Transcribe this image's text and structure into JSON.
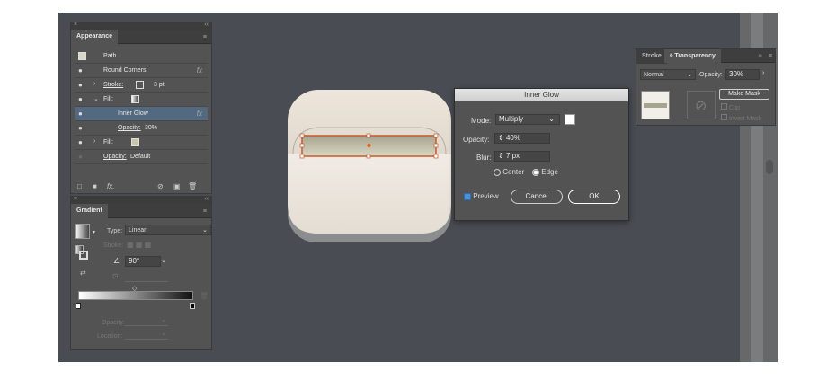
{
  "appearance": {
    "title": "Appearance",
    "rows": [
      {
        "label": "Path"
      },
      {
        "label": "Round Corners",
        "fx": "fx"
      },
      {
        "label": "Stroke:",
        "value": "3 pt"
      },
      {
        "label": "Fill:"
      },
      {
        "label": "Inner Glow",
        "fx": "fx"
      },
      {
        "label": "Opacity:",
        "value": "30%"
      },
      {
        "label": "Fill:"
      },
      {
        "label": "Opacity:",
        "value": "Default"
      }
    ],
    "bottom_fx": "fx."
  },
  "gradient": {
    "title": "Gradient",
    "type_label": "Type:",
    "type_value": "Linear",
    "stroke_label": "Stroke:",
    "angle_value": "90°",
    "opacity_label": "Opacity:",
    "location_label": "Location:"
  },
  "transparency": {
    "tab_stroke": "Stroke",
    "tab_transparency": "Transparency",
    "blend_mode": "Normal",
    "opacity_label": "Opacity:",
    "opacity_value": "30%",
    "make_mask": "Make Mask",
    "clip": "Clip",
    "invert_mask": "Invert Mask"
  },
  "inner_glow": {
    "title": "Inner Glow",
    "mode_label": "Mode:",
    "mode_value": "Multiply",
    "opacity_label": "Opacity:",
    "opacity_value": "40%",
    "blur_label": "Blur:",
    "blur_value": "7 px",
    "center_label": "Center",
    "edge_label": "Edge",
    "preview_label": "Preview",
    "cancel_label": "Cancel",
    "ok_label": "OK"
  }
}
